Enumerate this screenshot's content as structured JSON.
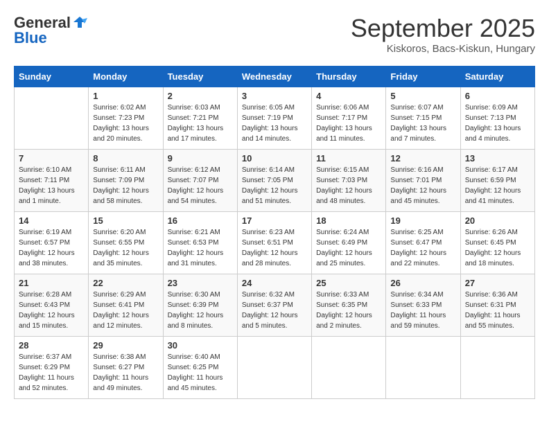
{
  "header": {
    "logo_general": "General",
    "logo_blue": "Blue",
    "month": "September 2025",
    "location": "Kiskoros, Bacs-Kiskun, Hungary"
  },
  "days_of_week": [
    "Sunday",
    "Monday",
    "Tuesday",
    "Wednesday",
    "Thursday",
    "Friday",
    "Saturday"
  ],
  "weeks": [
    [
      {
        "day": "",
        "info": ""
      },
      {
        "day": "1",
        "info": "Sunrise: 6:02 AM\nSunset: 7:23 PM\nDaylight: 13 hours\nand 20 minutes."
      },
      {
        "day": "2",
        "info": "Sunrise: 6:03 AM\nSunset: 7:21 PM\nDaylight: 13 hours\nand 17 minutes."
      },
      {
        "day": "3",
        "info": "Sunrise: 6:05 AM\nSunset: 7:19 PM\nDaylight: 13 hours\nand 14 minutes."
      },
      {
        "day": "4",
        "info": "Sunrise: 6:06 AM\nSunset: 7:17 PM\nDaylight: 13 hours\nand 11 minutes."
      },
      {
        "day": "5",
        "info": "Sunrise: 6:07 AM\nSunset: 7:15 PM\nDaylight: 13 hours\nand 7 minutes."
      },
      {
        "day": "6",
        "info": "Sunrise: 6:09 AM\nSunset: 7:13 PM\nDaylight: 13 hours\nand 4 minutes."
      }
    ],
    [
      {
        "day": "7",
        "info": "Sunrise: 6:10 AM\nSunset: 7:11 PM\nDaylight: 13 hours\nand 1 minute."
      },
      {
        "day": "8",
        "info": "Sunrise: 6:11 AM\nSunset: 7:09 PM\nDaylight: 12 hours\nand 58 minutes."
      },
      {
        "day": "9",
        "info": "Sunrise: 6:12 AM\nSunset: 7:07 PM\nDaylight: 12 hours\nand 54 minutes."
      },
      {
        "day": "10",
        "info": "Sunrise: 6:14 AM\nSunset: 7:05 PM\nDaylight: 12 hours\nand 51 minutes."
      },
      {
        "day": "11",
        "info": "Sunrise: 6:15 AM\nSunset: 7:03 PM\nDaylight: 12 hours\nand 48 minutes."
      },
      {
        "day": "12",
        "info": "Sunrise: 6:16 AM\nSunset: 7:01 PM\nDaylight: 12 hours\nand 45 minutes."
      },
      {
        "day": "13",
        "info": "Sunrise: 6:17 AM\nSunset: 6:59 PM\nDaylight: 12 hours\nand 41 minutes."
      }
    ],
    [
      {
        "day": "14",
        "info": "Sunrise: 6:19 AM\nSunset: 6:57 PM\nDaylight: 12 hours\nand 38 minutes."
      },
      {
        "day": "15",
        "info": "Sunrise: 6:20 AM\nSunset: 6:55 PM\nDaylight: 12 hours\nand 35 minutes."
      },
      {
        "day": "16",
        "info": "Sunrise: 6:21 AM\nSunset: 6:53 PM\nDaylight: 12 hours\nand 31 minutes."
      },
      {
        "day": "17",
        "info": "Sunrise: 6:23 AM\nSunset: 6:51 PM\nDaylight: 12 hours\nand 28 minutes."
      },
      {
        "day": "18",
        "info": "Sunrise: 6:24 AM\nSunset: 6:49 PM\nDaylight: 12 hours\nand 25 minutes."
      },
      {
        "day": "19",
        "info": "Sunrise: 6:25 AM\nSunset: 6:47 PM\nDaylight: 12 hours\nand 22 minutes."
      },
      {
        "day": "20",
        "info": "Sunrise: 6:26 AM\nSunset: 6:45 PM\nDaylight: 12 hours\nand 18 minutes."
      }
    ],
    [
      {
        "day": "21",
        "info": "Sunrise: 6:28 AM\nSunset: 6:43 PM\nDaylight: 12 hours\nand 15 minutes."
      },
      {
        "day": "22",
        "info": "Sunrise: 6:29 AM\nSunset: 6:41 PM\nDaylight: 12 hours\nand 12 minutes."
      },
      {
        "day": "23",
        "info": "Sunrise: 6:30 AM\nSunset: 6:39 PM\nDaylight: 12 hours\nand 8 minutes."
      },
      {
        "day": "24",
        "info": "Sunrise: 6:32 AM\nSunset: 6:37 PM\nDaylight: 12 hours\nand 5 minutes."
      },
      {
        "day": "25",
        "info": "Sunrise: 6:33 AM\nSunset: 6:35 PM\nDaylight: 12 hours\nand 2 minutes."
      },
      {
        "day": "26",
        "info": "Sunrise: 6:34 AM\nSunset: 6:33 PM\nDaylight: 11 hours\nand 59 minutes."
      },
      {
        "day": "27",
        "info": "Sunrise: 6:36 AM\nSunset: 6:31 PM\nDaylight: 11 hours\nand 55 minutes."
      }
    ],
    [
      {
        "day": "28",
        "info": "Sunrise: 6:37 AM\nSunset: 6:29 PM\nDaylight: 11 hours\nand 52 minutes."
      },
      {
        "day": "29",
        "info": "Sunrise: 6:38 AM\nSunset: 6:27 PM\nDaylight: 11 hours\nand 49 minutes."
      },
      {
        "day": "30",
        "info": "Sunrise: 6:40 AM\nSunset: 6:25 PM\nDaylight: 11 hours\nand 45 minutes."
      },
      {
        "day": "",
        "info": ""
      },
      {
        "day": "",
        "info": ""
      },
      {
        "day": "",
        "info": ""
      },
      {
        "day": "",
        "info": ""
      }
    ]
  ]
}
